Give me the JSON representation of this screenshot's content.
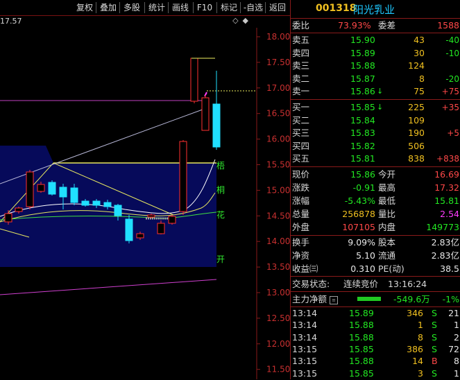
{
  "toolbar": {
    "buttons": [
      "复权",
      "叠加",
      "多股",
      "统计",
      "画线",
      "F10",
      "标记",
      "-自选",
      "返回"
    ]
  },
  "chart": {
    "current_price_label": "17.57",
    "header_icons": [
      "◇",
      "◆"
    ],
    "y_ticks": [
      "18.00",
      "17.50",
      "17.00",
      "16.50",
      "16.00",
      "15.50",
      "15.00",
      "14.50",
      "14.00",
      "13.50",
      "13.00",
      "12.50",
      "12.00",
      "11.50"
    ],
    "side_chars": [
      "梧",
      "桐",
      "花",
      "开"
    ],
    "colors": {
      "up": "#ff3030",
      "down": "#20e0ff",
      "panel": "#060a5a",
      "grid": "#8a1a1a"
    }
  },
  "quote": {
    "code": "001318",
    "name": "阳光乳业",
    "weibi_label": "委比",
    "weibi_value": "73.93%",
    "weicha_label": "委差",
    "weicha_value": "1588",
    "sell": [
      {
        "label": "卖五",
        "price": "15.90",
        "vol": "43",
        "chg": "-40"
      },
      {
        "label": "卖四",
        "price": "15.89",
        "vol": "30",
        "chg": "-10"
      },
      {
        "label": "卖三",
        "price": "15.88",
        "vol": "124",
        "chg": ""
      },
      {
        "label": "卖二",
        "price": "15.87",
        "vol": "8",
        "chg": "-20"
      },
      {
        "label": "卖一",
        "price": "15.86",
        "vol": "75",
        "chg": "+75",
        "arrow": "↓"
      }
    ],
    "buy": [
      {
        "label": "买一",
        "price": "15.85",
        "vol": "225",
        "chg": "+35",
        "arrow": "↓"
      },
      {
        "label": "买二",
        "price": "15.84",
        "vol": "109",
        "chg": ""
      },
      {
        "label": "买三",
        "price": "15.83",
        "vol": "190",
        "chg": "+5"
      },
      {
        "label": "买四",
        "price": "15.82",
        "vol": "506",
        "chg": ""
      },
      {
        "label": "买五",
        "price": "15.81",
        "vol": "838",
        "chg": "+838"
      }
    ],
    "stats": [
      {
        "l1": "现价",
        "v1": "15.86",
        "l2": "今开",
        "v2": "16.69"
      },
      {
        "l1": "涨跌",
        "v1": "-0.91",
        "l2": "最高",
        "v2": "17.32"
      },
      {
        "l1": "涨幅",
        "v1": "-5.43%",
        "l2": "最低",
        "v2": "15.81"
      },
      {
        "l1": "总量",
        "v1": "256878",
        "l2": "量比",
        "v2": "2.54"
      },
      {
        "l1": "外盘",
        "v1": "107105",
        "l2": "内盘",
        "v2": "149773"
      }
    ],
    "stats2": [
      {
        "l1": "换手",
        "v1": "9.09%",
        "l2": "股本",
        "v2": "2.83亿"
      },
      {
        "l1": "净资",
        "v1": "5.10",
        "l2": "流通",
        "v2": "2.83亿"
      },
      {
        "l1": "收益㈢",
        "v1": "0.310",
        "l2": "PE(动)",
        "v2": "38.5"
      }
    ],
    "trade_status_label": "交易状态:",
    "trade_status": "连续竞价",
    "trade_time": "13:16:24",
    "main_flow_label": "主力净额",
    "main_flow_value": "-549.6万",
    "main_flow_pct": "-1%",
    "ticks": [
      {
        "time": "13:14",
        "price": "15.89",
        "vol": "346",
        "bs": "S",
        "n": "21"
      },
      {
        "time": "13:14",
        "price": "15.88",
        "vol": "1",
        "bs": "S",
        "n": "1"
      },
      {
        "time": "13:14",
        "price": "15.88",
        "vol": "8",
        "bs": "S",
        "n": "2"
      },
      {
        "time": "13:15",
        "price": "15.85",
        "vol": "386",
        "bs": "S",
        "n": "72"
      },
      {
        "time": "13:15",
        "price": "15.88",
        "vol": "14",
        "bs": "B",
        "n": "8"
      },
      {
        "time": "13:15",
        "price": "15.85",
        "vol": "3",
        "bs": "S",
        "n": "1"
      }
    ]
  }
}
